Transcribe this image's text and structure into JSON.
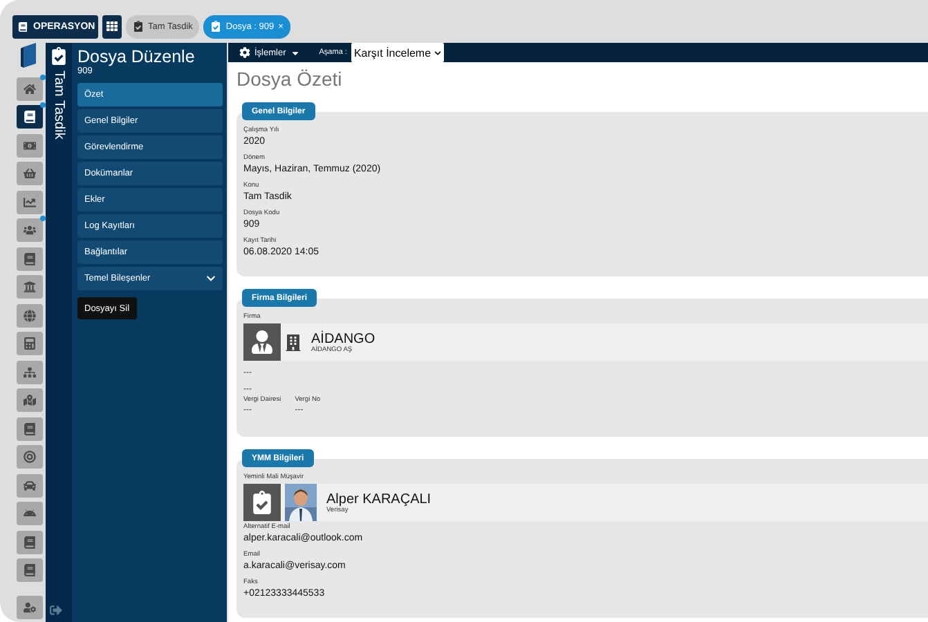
{
  "top_bar": {
    "app": "OPERASYON",
    "tabs": [
      {
        "label": "Tam Tasdik",
        "selected": false,
        "closable": false
      },
      {
        "label": "Dosya : 909",
        "selected": true,
        "closable": true,
        "close": "×"
      }
    ]
  },
  "rail": {
    "items": [
      {
        "selected": false,
        "badge": true
      },
      {
        "selected": true,
        "badge": true
      },
      {
        "selected": false,
        "badge": false
      },
      {
        "selected": false,
        "badge": false
      },
      {
        "selected": false,
        "badge": false
      },
      {
        "selected": false,
        "badge": true
      },
      {
        "selected": false,
        "badge": false
      },
      {
        "selected": false,
        "badge": false
      },
      {
        "selected": false,
        "badge": false
      },
      {
        "selected": false,
        "badge": false
      },
      {
        "selected": false,
        "badge": false
      },
      {
        "selected": false,
        "badge": false
      },
      {
        "selected": false,
        "badge": false
      },
      {
        "selected": false,
        "badge": false
      },
      {
        "selected": false,
        "badge": false
      },
      {
        "selected": false,
        "badge": false
      },
      {
        "selected": false,
        "badge": false
      },
      {
        "selected": false,
        "badge": false
      },
      {
        "selected": false,
        "badge": false
      }
    ]
  },
  "title_strip": {
    "text": "Tam Tasdik"
  },
  "menu": {
    "title": "Dosya Düzenle",
    "subtitle": "909",
    "items": [
      {
        "label": "Özet",
        "selected": true,
        "expandable": false
      },
      {
        "label": "Genel Bilgiler",
        "selected": false,
        "expandable": false
      },
      {
        "label": "Görevlendirme",
        "selected": false,
        "expandable": false
      },
      {
        "label": "Dokümanlar",
        "selected": false,
        "expandable": false
      },
      {
        "label": "Ekler",
        "selected": false,
        "expandable": false
      },
      {
        "label": "Log Kayıtları",
        "selected": false,
        "expandable": false
      },
      {
        "label": "Bağlantılar",
        "selected": false,
        "expandable": false
      },
      {
        "label": "Temel Bileşenler",
        "selected": false,
        "expandable": true
      }
    ],
    "delete_button": "Dosyayı Sil"
  },
  "toolbar": {
    "actions": "İşlemler",
    "stage_label": "Aşama :",
    "stage_value": "Karşıt İnceleme"
  },
  "page_title": "Dosya Özeti",
  "sections": [
    {
      "title": "Genel Bilgiler",
      "blocks": [
        {
          "kind": "field",
          "label": "Çalışma Yılı",
          "value": "2020"
        },
        {
          "kind": "field",
          "label": "Dönem",
          "value": "Mayıs, Haziran, Temmuz (2020)"
        },
        {
          "kind": "field",
          "label": "Konu",
          "value": "Tam Tasdik"
        },
        {
          "kind": "field",
          "label": "Dosya Kodu",
          "value": "909"
        },
        {
          "kind": "field",
          "label": "Kayıt Tarihi",
          "value": "06.08.2020 14:05"
        }
      ]
    },
    {
      "title": "Firma Bilgileri",
      "blocks": [
        {
          "kind": "company",
          "label": "Firma",
          "name": "AİDANGO",
          "sub": "AİDANGO AŞ"
        },
        {
          "kind": "text",
          "value": "---"
        },
        {
          "kind": "text",
          "value": "---"
        },
        {
          "kind": "pair",
          "fields": [
            {
              "label": "Vergi Dairesi",
              "value": "---"
            },
            {
              "label": "Vergi No",
              "value": "---"
            }
          ]
        }
      ]
    },
    {
      "title": "YMM Bilgileri",
      "blocks": [
        {
          "kind": "person",
          "label": "Yeminli Mali Müşavir",
          "name": "Alper KARAÇALI",
          "sub": "Verisay"
        },
        {
          "kind": "field",
          "label": "Alternatif E-mail",
          "value": "alper.karacali@outlook.com"
        },
        {
          "kind": "field",
          "label": "Email",
          "value": "a.karacali@verisay.com"
        },
        {
          "kind": "field",
          "label": "Faks",
          "value": "+02123333445533"
        }
      ]
    }
  ]
}
